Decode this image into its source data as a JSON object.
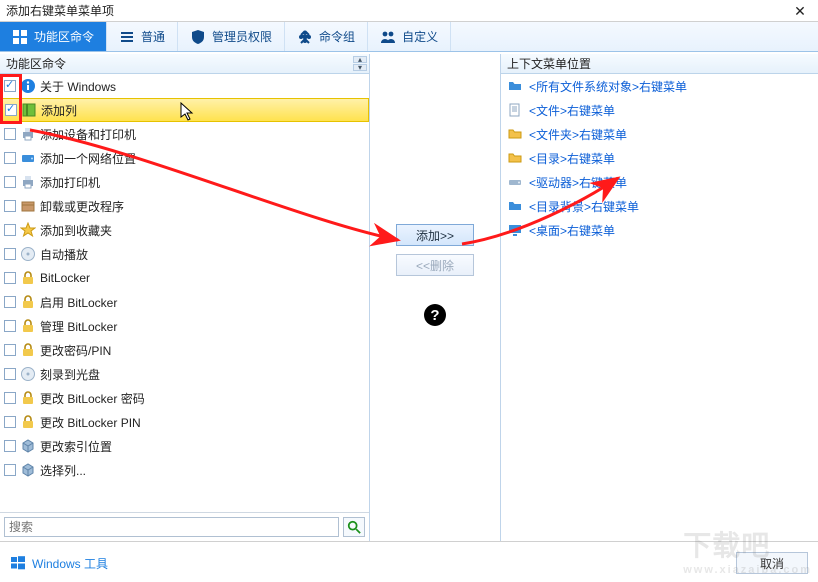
{
  "window": {
    "title": "添加右键菜单菜单项"
  },
  "toolbar": {
    "items": [
      {
        "id": "ribbon",
        "label": "功能区命令",
        "active": true
      },
      {
        "id": "common",
        "label": "普通"
      },
      {
        "id": "admin",
        "label": "管理员权限"
      },
      {
        "id": "group",
        "label": "命令组"
      },
      {
        "id": "custom",
        "label": "自定义"
      }
    ]
  },
  "left_panel": {
    "header": "功能区命令",
    "items": [
      {
        "label": "关于 Windows",
        "checked": true,
        "icon": "info-blue"
      },
      {
        "label": "添加列",
        "checked": true,
        "icon": "green-box",
        "selected": true
      },
      {
        "label": "添加设备和打印机",
        "checked": false,
        "icon": "printer"
      },
      {
        "label": "添加一个网络位置",
        "checked": false,
        "icon": "drive-blue"
      },
      {
        "label": "添加打印机",
        "checked": false,
        "icon": "printer"
      },
      {
        "label": "卸载或更改程序",
        "checked": false,
        "icon": "box"
      },
      {
        "label": "添加到收藏夹",
        "checked": false,
        "icon": "star"
      },
      {
        "label": "自动播放",
        "checked": false,
        "icon": "disc"
      },
      {
        "label": "BitLocker",
        "checked": false,
        "icon": "lock-y"
      },
      {
        "label": "启用 BitLocker",
        "checked": false,
        "icon": "lock-y"
      },
      {
        "label": "管理 BitLocker",
        "checked": false,
        "icon": "lock-y"
      },
      {
        "label": "更改密码/PIN",
        "checked": false,
        "icon": "lock-y"
      },
      {
        "label": "刻录到光盘",
        "checked": false,
        "icon": "disc"
      },
      {
        "label": "更改 BitLocker 密码",
        "checked": false,
        "icon": "lock-y"
      },
      {
        "label": "更改 BitLocker PIN",
        "checked": false,
        "icon": "lock-y"
      },
      {
        "label": "更改索引位置",
        "checked": false,
        "icon": "cube"
      },
      {
        "label": "选择列...",
        "checked": false,
        "icon": "cube"
      }
    ]
  },
  "mid": {
    "add_label": "添加>>",
    "remove_label": "<<删除"
  },
  "right_panel": {
    "header": "上下文菜单位置",
    "items": [
      {
        "label": "<所有文件系统对象>右键菜单",
        "icon": "folder-blue"
      },
      {
        "label": "<文件>右键菜单",
        "icon": "doc"
      },
      {
        "label": "<文件夹>右键菜单",
        "icon": "folder-yellow"
      },
      {
        "label": "<目录>右键菜单",
        "icon": "folder-yellow"
      },
      {
        "label": "<驱动器>右键菜单",
        "icon": "drive"
      },
      {
        "label": "<目录背景>右键菜单",
        "icon": "folder-blue"
      },
      {
        "label": "<桌面>右键菜单",
        "icon": "desktop"
      }
    ]
  },
  "search": {
    "placeholder": "搜索"
  },
  "footer": {
    "tools_label": "Windows 工具",
    "cancel_label": "取消"
  },
  "watermark": "下载吧"
}
